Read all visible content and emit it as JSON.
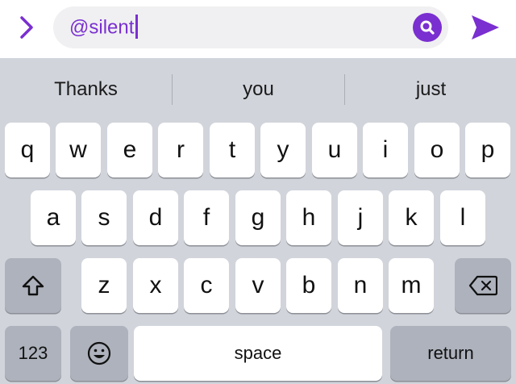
{
  "input": {
    "value": "@silent",
    "expand_icon": "chevron-right-icon",
    "search_icon": "search-icon",
    "send_icon": "send-icon"
  },
  "suggestions": [
    "Thanks",
    "you",
    "just"
  ],
  "keyboard": {
    "row1": [
      "q",
      "w",
      "e",
      "r",
      "t",
      "y",
      "u",
      "i",
      "o",
      "p"
    ],
    "row2": [
      "a",
      "s",
      "d",
      "f",
      "g",
      "h",
      "j",
      "k",
      "l"
    ],
    "row3": [
      "z",
      "x",
      "c",
      "v",
      "b",
      "n",
      "m"
    ],
    "numbers_label": "123",
    "space_label": "space",
    "return_label": "return",
    "shift_icon": "shift-icon",
    "delete_icon": "delete-icon",
    "emoji_icon": "emoji-icon"
  },
  "colors": {
    "accent": "#7a2fd0",
    "keyboard_bg": "#d1d4db",
    "key_bg": "#ffffff",
    "function_key_bg": "#adb2bc"
  }
}
